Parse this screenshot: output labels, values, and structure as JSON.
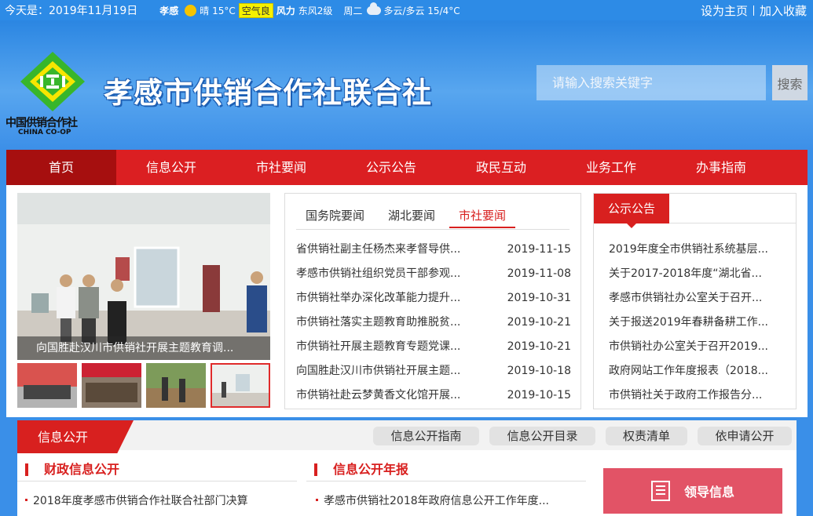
{
  "topbar": {
    "date_text": "今天是：2019年11月19日",
    "weather": {
      "city": "孝感",
      "today_cond": "晴 15°C",
      "air_quality": "空气良",
      "wind_label": "风力",
      "wind_value": "东风2级",
      "tomorrow_day": "周二",
      "tomorrow_cond": "多云/多云 15/4°C"
    },
    "set_home": "设为主页",
    "add_favorite": "加入收藏"
  },
  "header": {
    "logo_cn": "中国供销合作社",
    "logo_en": "CHINA CO-OP",
    "title": "孝感市供销合作社联合社",
    "search_placeholder": "请输入搜索关键字",
    "search_button": "搜索"
  },
  "nav": {
    "items": [
      {
        "label": "首页",
        "active": true
      },
      {
        "label": "信息公开"
      },
      {
        "label": "市社要闻"
      },
      {
        "label": "公示公告"
      },
      {
        "label": "政民互动"
      },
      {
        "label": "业务工作"
      },
      {
        "label": "办事指南"
      }
    ]
  },
  "slider": {
    "caption": "向国胜赴汉川市供销社开展主题教育调..."
  },
  "news": {
    "tabs": [
      "国务院要闻",
      "湖北要闻",
      "市社要闻"
    ],
    "active_tab": 2,
    "items": [
      {
        "title": "省供销社副主任杨杰来孝督导供...",
        "date": "2019-11-15"
      },
      {
        "title": "孝感市供销社组织党员干部参观...",
        "date": "2019-11-08"
      },
      {
        "title": "市供销社举办深化改革能力提升...",
        "date": "2019-10-31"
      },
      {
        "title": "市供销社落实主题教育助推脱贫...",
        "date": "2019-10-21"
      },
      {
        "title": "市供销社开展主题教育专题党课...",
        "date": "2019-10-21"
      },
      {
        "title": "向国胜赴汉川市供销社开展主题...",
        "date": "2019-10-18"
      },
      {
        "title": "市供销社赴云梦黄香文化馆开展...",
        "date": "2019-10-15"
      }
    ]
  },
  "notice": {
    "title": "公示公告",
    "items": [
      "2019年度全市供销社系统基层...",
      "关于2017-2018年度“湖北省...",
      "孝感市供销社办公室关于召开...",
      "关于报送2019年春耕备耕工作...",
      "市供销社办公室关于召开2019...",
      "政府网站工作年度报表（2018...",
      "市供销社关于政府工作报告分..."
    ]
  },
  "info": {
    "title": "信息公开",
    "links": [
      "信息公开指南",
      "信息公开目录",
      "权责清单",
      "依申请公开"
    ],
    "left_head": "财政信息公开",
    "left_item": "2018年度孝感市供销合作社联合社部门决算",
    "mid_head": "信息公开年报",
    "mid_item": "孝感市供销社2018年政府信息公开工作年度...",
    "leader_label": "领导信息"
  },
  "colors": {
    "brand_red": "#db1f22",
    "nav_active": "#a60f0f",
    "sky_blue": "#3a8fe8",
    "logo_green": "#38b62b"
  }
}
